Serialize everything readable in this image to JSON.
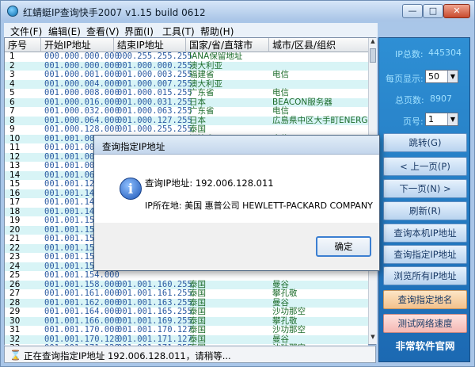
{
  "window": {
    "title": "红蜻蜓IP查询快手2007 v1.15 build 0612",
    "min_label": "—",
    "max_label": "□",
    "close_label": "✕"
  },
  "menu": [
    {
      "label": "文件(F)"
    },
    {
      "label": "编辑(E)"
    },
    {
      "label": "查看(V)"
    },
    {
      "label": "界面(I)"
    },
    {
      "label": "工具(T)"
    },
    {
      "label": "帮助(H)"
    }
  ],
  "table": {
    "headers": [
      "序号",
      "开始IP地址",
      "结束IP地址",
      "国家/省/直辖市",
      "城市/区县/组织"
    ],
    "rows": [
      [
        "1",
        "000.000.000.000",
        "000.255.255.255",
        "IANA保留地址",
        ""
      ],
      [
        "2",
        "001.000.000.000",
        "001.000.000.255",
        "澳大利亚",
        ""
      ],
      [
        "3",
        "001.000.001.000",
        "001.000.003.255",
        "福建省",
        "电信"
      ],
      [
        "4",
        "001.000.004.000",
        "001.000.007.255",
        "澳大利亚",
        ""
      ],
      [
        "5",
        "001.000.008.000",
        "001.000.015.255",
        "广东省",
        "电信"
      ],
      [
        "6",
        "001.000.016.000",
        "001.000.031.255",
        "日本",
        "BEACON服务器"
      ],
      [
        "7",
        "001.000.032.000",
        "001.000.063.255",
        "广东省",
        "电信"
      ],
      [
        "8",
        "001.000.064.000",
        "001.000.127.255",
        "日本",
        "広島県中区大手町ENERGIA通"
      ],
      [
        "9",
        "001.000.128.000",
        "001.000.255.255",
        "泰国",
        ""
      ],
      [
        "10",
        "001.001.000.000",
        "001.001.000.255",
        "福建省",
        "电信"
      ],
      [
        "11",
        "001.001.001.000",
        "",
        "",
        ""
      ],
      [
        "12",
        "001.001.002.000",
        "",
        "",
        ""
      ],
      [
        "13",
        "001.001.008.000",
        "",
        "",
        ""
      ],
      [
        "14",
        "001.001.064.000",
        "",
        "",
        ""
      ],
      [
        "15",
        "001.001.128.000",
        "",
        "",
        ""
      ],
      [
        "16",
        "001.001.144.000",
        "",
        "",
        ""
      ],
      [
        "17",
        "001.001.145.000",
        "",
        "",
        ""
      ],
      [
        "18",
        "001.001.148.000",
        "",
        "",
        ""
      ],
      [
        "19",
        "001.001.150.000",
        "",
        "",
        ""
      ],
      [
        "20",
        "001.001.150.128",
        "",
        "",
        ""
      ],
      [
        "21",
        "001.001.151.000",
        "",
        "",
        ""
      ],
      [
        "22",
        "001.001.152.000",
        "",
        "",
        ""
      ],
      [
        "23",
        "001.001.152.128",
        "",
        "",
        ""
      ],
      [
        "24",
        "001.001.153.000",
        "",
        "",
        ""
      ],
      [
        "25",
        "001.001.154.000",
        "",
        "",
        ""
      ],
      [
        "26",
        "001.001.158.000",
        "001.001.160.255",
        "泰国",
        "曼谷"
      ],
      [
        "27",
        "001.001.161.000",
        "001.001.161.255",
        "泰国",
        "攀孔敬"
      ],
      [
        "28",
        "001.001.162.000",
        "001.001.163.255",
        "泰国",
        "曼谷"
      ],
      [
        "29",
        "001.001.164.000",
        "001.001.165.255",
        "泰国",
        "沙功那空"
      ],
      [
        "30",
        "001.001.166.000",
        "001.001.169.255",
        "泰国",
        "攀孔敬"
      ],
      [
        "31",
        "001.001.170.000",
        "001.001.170.127",
        "泰国",
        "沙功那空"
      ],
      [
        "32",
        "001.001.170.128",
        "001.001.171.127",
        "泰国",
        "曼谷"
      ],
      [
        "33",
        "001.001.171.128",
        "001.001.171.255",
        "泰国",
        "沙功那空"
      ]
    ]
  },
  "status": {
    "icon": "⌛",
    "text": "正在查询指定IP地址 192.006.128.011，请稍等..."
  },
  "panel": {
    "ip_total_label": "IP总数:",
    "ip_total": "445304",
    "per_page_label": "每页显示:",
    "per_page": "50",
    "total_pages_label": "总页数:",
    "total_pages": "8907",
    "page_label": "页号:",
    "page": "1",
    "buttons": [
      "跳转(G)",
      "< 上一页(P)",
      "下一页(N) >",
      "刷新(R)",
      "查询本机IP地址",
      "查询指定IP地址",
      "浏览所有IP地址",
      "查询指定地名",
      "测试网络速度"
    ],
    "brand": "非常软件官网"
  },
  "dialog": {
    "title": "查询指定IP地址",
    "icon": "i",
    "line1": "查询IP地址: 192.006.128.011",
    "line2": "IP所在地: 美国 惠普公司 HEWLETT-PACKARD COMPANY",
    "ok": "确定"
  }
}
